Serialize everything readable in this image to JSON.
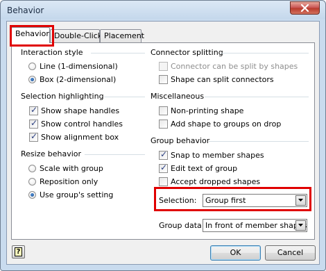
{
  "window": {
    "title": "Behavior"
  },
  "tabs": [
    {
      "label": "Behavior",
      "selected": true
    },
    {
      "label": "Double-Click",
      "selected": false
    },
    {
      "label": "Placement",
      "selected": false
    }
  ],
  "interaction_style": {
    "title": "Interaction style",
    "options": [
      {
        "label": "Line (1-dimensional)",
        "checked": false
      },
      {
        "label": "Box (2-dimensional)",
        "checked": true
      }
    ]
  },
  "selection_highlighting": {
    "title": "Selection highlighting",
    "options": [
      {
        "label": "Show shape handles",
        "checked": true
      },
      {
        "label": "Show control handles",
        "checked": true
      },
      {
        "label": "Show alignment box",
        "checked": true
      }
    ]
  },
  "resize_behavior": {
    "title": "Resize behavior",
    "options": [
      {
        "label": "Scale with group",
        "checked": false
      },
      {
        "label": "Reposition only",
        "checked": false
      },
      {
        "label": "Use group's setting",
        "checked": true
      }
    ]
  },
  "connector_splitting": {
    "title": "Connector splitting",
    "options": [
      {
        "label": "Connector can be split by shapes",
        "checked": false,
        "enabled": false
      },
      {
        "label": "Shape can split connectors",
        "checked": false,
        "enabled": true
      }
    ]
  },
  "miscellaneous": {
    "title": "Miscellaneous",
    "options": [
      {
        "label": "Non-printing shape",
        "checked": false
      },
      {
        "label": "Add shape to groups on drop",
        "checked": false
      }
    ]
  },
  "group_behavior": {
    "title": "Group behavior",
    "options": [
      {
        "label": "Snap to member shapes",
        "checked": true
      },
      {
        "label": "Edit text of group",
        "checked": true
      },
      {
        "label": "Accept dropped shapes",
        "checked": false
      }
    ],
    "selection_label": "Selection:",
    "selection_value": "Group first",
    "group_data_label": "Group data:",
    "group_data_value": "In front of member shapes"
  },
  "buttons": {
    "help": "?",
    "ok": "OK",
    "cancel": "Cancel"
  },
  "colors": {
    "highlight_box": "#e00000",
    "accent_radio": "#1c4f8e"
  }
}
